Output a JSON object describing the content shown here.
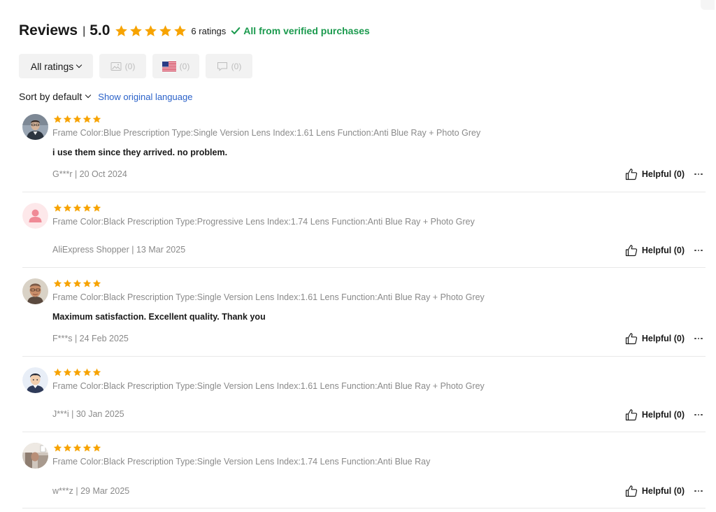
{
  "header": {
    "title": "Reviews",
    "separator": "|",
    "score": "5.0",
    "star_count": 5,
    "ratings_count": "6 ratings",
    "verified_text": "All from verified purchases"
  },
  "colors": {
    "star": "#f7a300",
    "verified": "#1b9a4e",
    "link": "#2b62c9"
  },
  "filters": {
    "all_ratings": "All ratings",
    "photos": {
      "icon": "image-icon",
      "count": "(0)"
    },
    "country": {
      "icon": "us-flag-icon",
      "count": "(0)"
    },
    "comments": {
      "icon": "comment-icon",
      "count": "(0)"
    }
  },
  "sort": {
    "label": "Sort by default",
    "show_original": "Show original language"
  },
  "reviews": [
    {
      "avatar": "avatar-photo-man-glasses",
      "rating": 5,
      "attributes": "Frame Color:Blue Prescription Type:Single Version Lens Index:1.61 Lens Function:Anti Blue Ray + Photo Grey",
      "text": "i use them since they arrived. no problem.",
      "author_date": "G***r | 20 Oct 2024",
      "helpful": "Helpful (0)"
    },
    {
      "avatar": "avatar-default-pink",
      "rating": 5,
      "attributes": "Frame Color:Black Prescription Type:Progressive Lens Index:1.74 Lens Function:Anti Blue Ray + Photo Grey",
      "text": "",
      "author_date": "AliExpress Shopper | 13 Mar 2025",
      "helpful": "Helpful (0)"
    },
    {
      "avatar": "avatar-photo-older-man",
      "rating": 5,
      "attributes": "Frame Color:Black Prescription Type:Single Version Lens Index:1.61 Lens Function:Anti Blue Ray + Photo Grey",
      "text": "Maximum satisfaction. Excellent quality. Thank you",
      "author_date": "F***s | 24 Feb 2025",
      "helpful": "Helpful (0)"
    },
    {
      "avatar": "avatar-cartoon-man",
      "rating": 5,
      "attributes": "Frame Color:Black Prescription Type:Single Version Lens Index:1.61 Lens Function:Anti Blue Ray + Photo Grey",
      "text": "",
      "author_date": "J***i | 30 Jan 2025",
      "helpful": "Helpful (0)"
    },
    {
      "avatar": "avatar-photo-room",
      "rating": 5,
      "attributes": "Frame Color:Black Prescription Type:Single Version Lens Index:1.74 Lens Function:Anti Blue Ray",
      "text": "",
      "author_date": "w***z | 29 Mar 2025",
      "helpful": "Helpful (0)"
    }
  ]
}
